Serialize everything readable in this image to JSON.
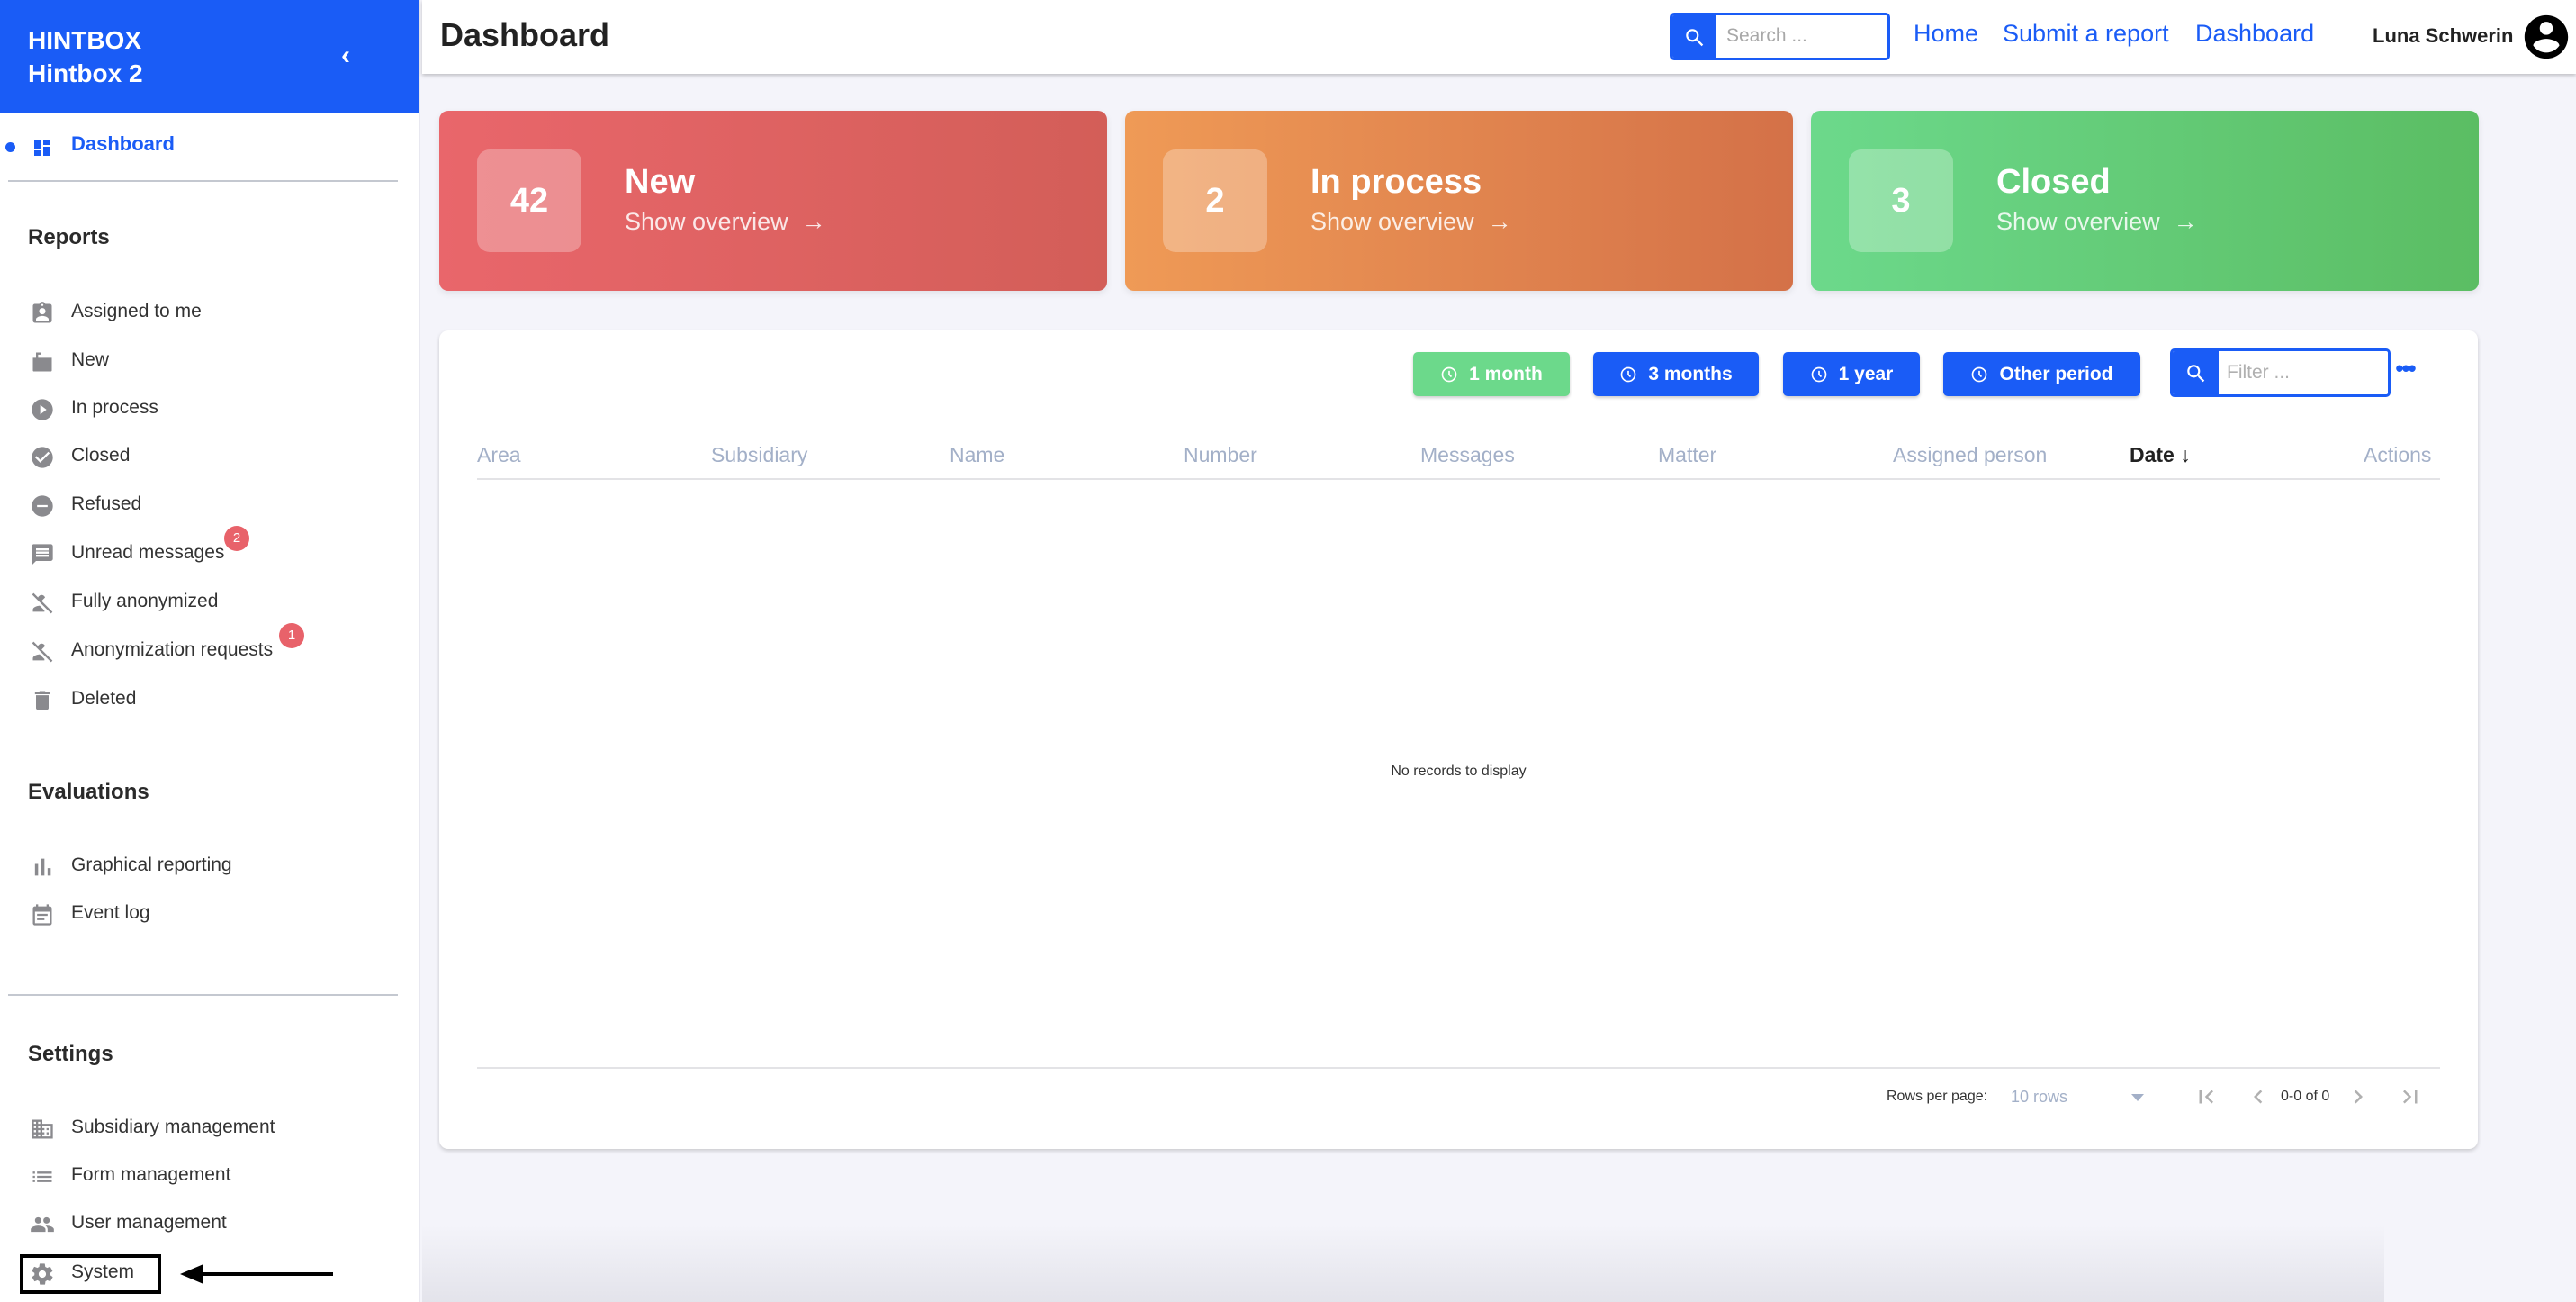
{
  "brand": {
    "line1": "HINTBOX",
    "line2": "Hintbox 2",
    "collapse_icon": "chevron-left-icon"
  },
  "sidebar": {
    "active_item": {
      "label": "Dashboard",
      "icon": "dashboard-icon"
    },
    "sections": [
      {
        "title": "Reports",
        "items": [
          {
            "label": "Assigned to me",
            "icon": "assignment-ind-icon"
          },
          {
            "label": "New",
            "icon": "new-folder-icon"
          },
          {
            "label": "In process",
            "icon": "play-circle-icon"
          },
          {
            "label": "Closed",
            "icon": "check-circle-icon"
          },
          {
            "label": "Refused",
            "icon": "minus-circle-icon"
          },
          {
            "label": "Unread messages",
            "icon": "message-icon",
            "badge": "2"
          },
          {
            "label": "Fully anonymized",
            "icon": "person-off-icon"
          },
          {
            "label": "Anonymization requests",
            "icon": "person-off-icon",
            "badge": "1"
          },
          {
            "label": "Deleted",
            "icon": "trash-icon"
          }
        ]
      },
      {
        "title": "Evaluations",
        "items": [
          {
            "label": "Graphical reporting",
            "icon": "bar-chart-icon"
          },
          {
            "label": "Event log",
            "icon": "calendar-icon"
          }
        ]
      },
      {
        "title": "Settings",
        "items": [
          {
            "label": "Subsidiary management",
            "icon": "building-icon"
          },
          {
            "label": "Form management",
            "icon": "list-icon"
          },
          {
            "label": "User management",
            "icon": "people-icon"
          },
          {
            "label": "System",
            "icon": "gear-icon",
            "highlighted": true
          }
        ]
      }
    ]
  },
  "header": {
    "title": "Dashboard",
    "search_placeholder": "Search ...",
    "links": [
      "Home",
      "Submit a report",
      "Dashboard"
    ],
    "user_name": "Luna Schwerin"
  },
  "cards": [
    {
      "count": "42",
      "title": "New",
      "link": "Show overview",
      "arrow": "→"
    },
    {
      "count": "2",
      "title": "In process",
      "link": "Show overview",
      "arrow": "→"
    },
    {
      "count": "3",
      "title": "Closed",
      "link": "Show overview",
      "arrow": "→"
    }
  ],
  "colors": {
    "accent": "#1a5cf6",
    "new": "#e9666b",
    "in_process": "#ef9a56",
    "closed": "#6cd98b",
    "badge": "#e8626a"
  },
  "table": {
    "period_buttons": [
      {
        "label": "1 month",
        "active": true
      },
      {
        "label": "3 months",
        "active": false
      },
      {
        "label": "1 year",
        "active": false
      },
      {
        "label": "Other period",
        "active": false
      }
    ],
    "filter_placeholder": "Filter ...",
    "more_label": "•••",
    "columns": [
      "Area",
      "Subsidiary",
      "Name",
      "Number",
      "Messages",
      "Matter",
      "Assigned person",
      "Date ↓",
      "Actions"
    ],
    "sorted_column": "Date",
    "rows": [],
    "empty_message": "No records to display",
    "pagination": {
      "rows_per_page_label": "Rows per page:",
      "rows_per_page_value": "10 rows",
      "range": "0-0 of 0"
    }
  }
}
